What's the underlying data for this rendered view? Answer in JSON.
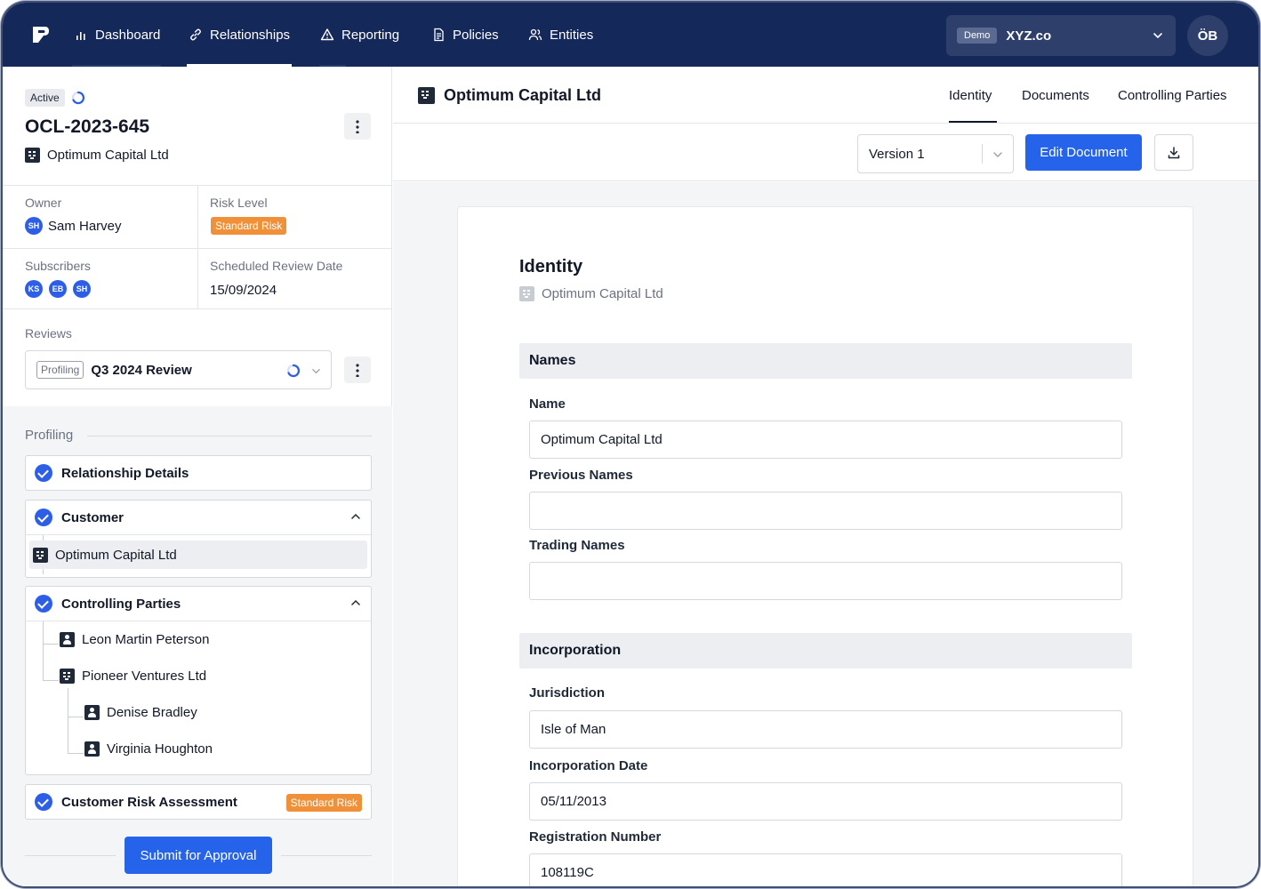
{
  "nav": {
    "items": [
      {
        "label": "Dashboard",
        "icon": "bar-chart-icon"
      },
      {
        "label": "Relationships",
        "icon": "link-icon"
      },
      {
        "label": "Reporting",
        "icon": "warning-triangle-icon"
      },
      {
        "label": "Policies",
        "icon": "document-icon"
      },
      {
        "label": "Entities",
        "icon": "users-icon"
      }
    ],
    "active": "Relationships",
    "org_badge": "Demo",
    "org_name": "XYZ.co",
    "user_initials": "ÖB"
  },
  "case": {
    "status": "Active",
    "id": "OCL-2023-645",
    "entity": "Optimum Capital Ltd",
    "owner_label": "Owner",
    "owner_initials": "SH",
    "owner_name": "Sam Harvey",
    "risk_label": "Risk Level",
    "risk_value": "Standard Risk",
    "subscribers_label": "Subscribers",
    "subscribers": [
      "KS",
      "EB",
      "SH"
    ],
    "review_date_label": "Scheduled Review Date",
    "review_date": "15/09/2024",
    "reviews_label": "Reviews",
    "review_stage": "Profiling",
    "review_name": "Q3 2024 Review"
  },
  "profiling": {
    "title": "Profiling",
    "steps": {
      "relationship_details": "Relationship Details",
      "customer": "Customer",
      "customer_entity": "Optimum Capital Ltd",
      "controlling_parties": "Controlling Parties",
      "parties": [
        {
          "name": "Leon Martin Peterson",
          "type": "person"
        },
        {
          "name": "Pioneer Ventures Ltd",
          "type": "company"
        },
        {
          "name": "Denise Bradley",
          "type": "person"
        },
        {
          "name": "Virginia Houghton",
          "type": "person"
        }
      ],
      "risk_assessment": "Customer Risk Assessment",
      "risk_assessment_badge": "Standard Risk"
    },
    "submit_label": "Submit for Approval"
  },
  "document": {
    "header_title": "Optimum Capital Ltd",
    "tabs": [
      "Identity",
      "Documents",
      "Controlling Parties"
    ],
    "active_tab": "Identity",
    "version": "Version 1",
    "edit_label": "Edit Document",
    "heading": "Identity",
    "subheading": "Optimum Capital Ltd",
    "sections": {
      "names": "Names",
      "incorporation": "Incorporation"
    },
    "fields": {
      "name_label": "Name",
      "name_value": "Optimum Capital Ltd",
      "previous_names_label": "Previous Names",
      "previous_names_value": "",
      "trading_names_label": "Trading Names",
      "trading_names_value": "",
      "jurisdiction_label": "Jurisdiction",
      "jurisdiction_value": "Isle of Man",
      "incorporation_date_label": "Incorporation Date",
      "incorporation_date_value": "05/11/2013",
      "registration_number_label": "Registration Number",
      "registration_number_value": "108119C"
    }
  },
  "colors": {
    "nav_bg": "#15285a",
    "primary": "#2563eb",
    "risk_orange": "#f0913a"
  }
}
